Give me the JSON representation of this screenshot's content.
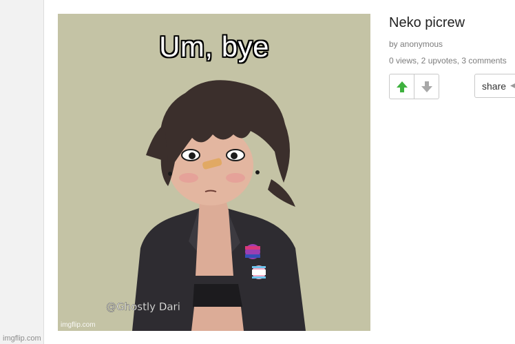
{
  "site_watermark": "imgflip.com",
  "meme": {
    "caption": "Um, bye",
    "watermark": "imgflip.com",
    "signature": "@Ghostly Dari",
    "background": "#c4c3a5"
  },
  "post": {
    "title": "Neko picrew",
    "author": "by anonymous",
    "stats": "0 views, 2 upvotes, 3 comments"
  },
  "actions": {
    "upvote_icon": "arrow-up-icon",
    "upvote_color": "#3eb13e",
    "downvote_icon": "arrow-down-icon",
    "share_label": "share"
  }
}
